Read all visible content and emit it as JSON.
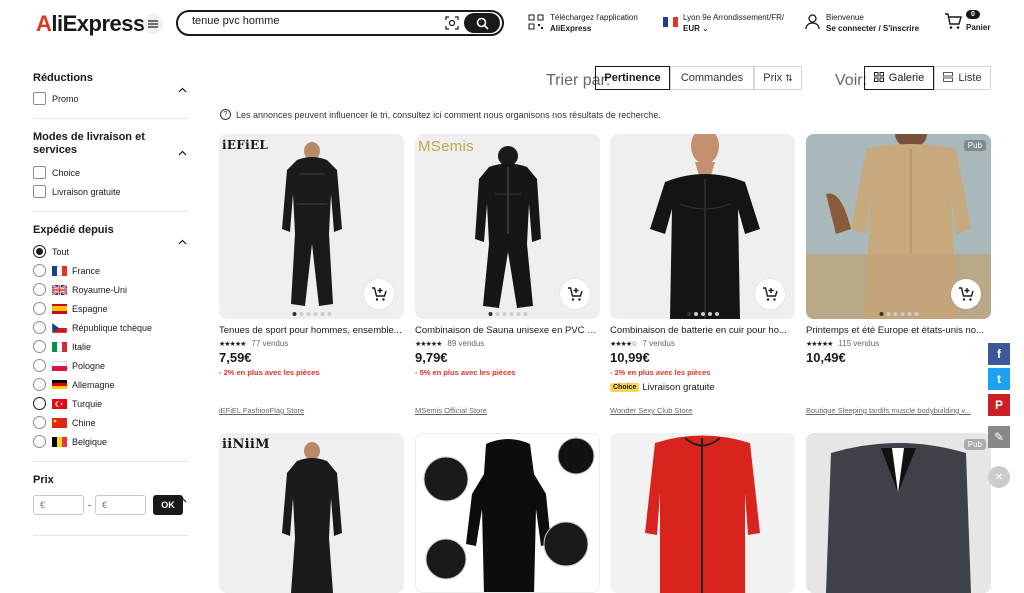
{
  "header": {
    "logo": "AliExpress",
    "search_value": "tenue pvc homme",
    "app_line1": "Téléchargez l'application",
    "app_line2": "AliExpress",
    "locale_line1": "Lyon 9e Arrondissement/FR/",
    "locale_line2": "EUR",
    "account_line1": "Bienvenue",
    "account_line2": "Se connecter / S'inscrire",
    "cart_count": "0",
    "cart_label": "Panier"
  },
  "sidebar": {
    "reductions": {
      "title": "Réductions",
      "options": [
        "Promo"
      ]
    },
    "livraison": {
      "title": "Modes de livraison et services",
      "options": [
        "Choice",
        "Livraison gratuite"
      ]
    },
    "expedie": {
      "title": "Expédié depuis",
      "options": [
        "Tout",
        "France",
        "Royaume-Uni",
        "Espagne",
        "République tchèque",
        "Italie",
        "Pologne",
        "Allemagne",
        "Turquie",
        "Chine",
        "Belgique"
      ]
    },
    "prix": {
      "title": "Prix",
      "min_placeholder": "€",
      "max_placeholder": "€",
      "separator": "-",
      "ok": "OK"
    }
  },
  "sort": {
    "label": "Trier par:",
    "options": [
      "Pertinence",
      "Commandes",
      "Prix"
    ],
    "active": "Pertinence",
    "view_label": "Voir:",
    "view_options": [
      "Galerie",
      "Liste"
    ],
    "view_active": "Galerie"
  },
  "notice": "Les annonces peuvent influencer le tri, consultez ici comment nous organisons nos résultats de recherche.",
  "products": [
    {
      "brand": "iEFiEL",
      "title": "Tenues de sport pour hommes, ensemble...",
      "stars": "★★★★★",
      "sold": "77 vendus",
      "price": "7,59€",
      "promo": "- 2% en plus avec les pièces",
      "store": "iEFiEL FashionFlag Store"
    },
    {
      "brand": "MSemis",
      "title": "Combinaison de Sauna unisexe en PVC p...",
      "stars": "★★★★★",
      "sold": "89 vendus",
      "price": "9,79€",
      "promo": "- 5% en plus avec les pièces",
      "store": "MSemis Official Store"
    },
    {
      "brand": "",
      "title": "Combinaison de batterie en cuir pour ho...",
      "stars": "★★★★☆",
      "sold": "7 vendus",
      "price": "10,99€",
      "promo": "- 2% en plus avec les pièces",
      "choice_tag": "Choice",
      "choice_text": "Livraison gratuite",
      "store": "Wonder Sexy Club Store"
    },
    {
      "brand": "",
      "pub": "Pub",
      "title": "Printemps et été Europe et états-unis no...",
      "stars": "★★★★★",
      "sold": "115 vendus",
      "price": "10,49€",
      "store": "Boutique Sleeping tardifs muscle bodybuilding v..."
    },
    {
      "brand": "iiNiiM"
    },
    {
      "brand": ""
    },
    {
      "brand": ""
    },
    {
      "brand": "",
      "pub": "Pub"
    }
  ],
  "share": [
    "f",
    "t",
    "P",
    "✎",
    "✕"
  ],
  "colors": {
    "accent": "#e43225",
    "facebook": "#3b5998",
    "twitter": "#1da1f2",
    "pinterest": "#cb2027"
  }
}
